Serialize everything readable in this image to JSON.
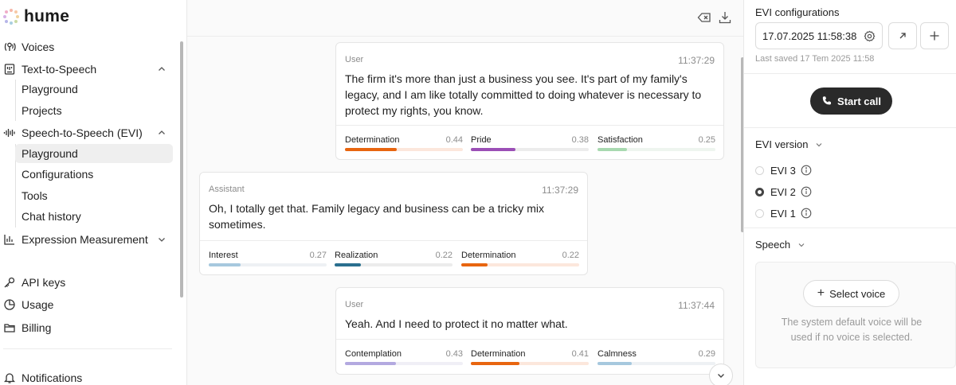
{
  "brand": {
    "name": "hume"
  },
  "sidebar": {
    "voices": "Voices",
    "tts": {
      "label": "Text-to-Speech",
      "items": [
        "Playground",
        "Projects"
      ]
    },
    "sts": {
      "label": "Speech-to-Speech (EVI)",
      "items": [
        "Playground",
        "Configurations",
        "Tools",
        "Chat history"
      ],
      "active": "Playground"
    },
    "expression": "Expression Measurement",
    "api_keys": "API keys",
    "usage": "Usage",
    "billing": "Billing",
    "notifications": "Notifications"
  },
  "chat": {
    "messages": [
      {
        "role": "User",
        "time": "11:37:29",
        "text": "The firm it's more than just a business you see. It's part of my family's legacy, and I am like totally committed to doing whatever is necessary to protect my rights, you know.",
        "emotions": [
          {
            "name": "Determination",
            "score": "0.44",
            "value": 0.44,
            "color": "#e8650f",
            "track": "#fce7dc"
          },
          {
            "name": "Pride",
            "score": "0.38",
            "value": 0.38,
            "color": "#9b4fb6",
            "track": "#ececec"
          },
          {
            "name": "Satisfaction",
            "score": "0.25",
            "value": 0.25,
            "color": "#a8d9b0",
            "track": "#eef5ef"
          }
        ]
      },
      {
        "role": "Assistant",
        "time": "11:37:29",
        "text": "Oh, I totally get that. Family legacy and business can be a tricky mix sometimes.",
        "emotions": [
          {
            "name": "Interest",
            "score": "0.27",
            "value": 0.27,
            "color": "#a6c8de",
            "track": "#eef1f4"
          },
          {
            "name": "Realization",
            "score": "0.22",
            "value": 0.22,
            "color": "#2a6f8f",
            "track": "#ececec"
          },
          {
            "name": "Determination",
            "score": "0.22",
            "value": 0.22,
            "color": "#e8650f",
            "track": "#fce7dc"
          }
        ]
      },
      {
        "role": "User",
        "time": "11:37:44",
        "text": "Yeah. And I need to protect it no matter what.",
        "emotions": [
          {
            "name": "Contemplation",
            "score": "0.43",
            "value": 0.43,
            "color": "#b3a9e0",
            "track": "#f0eff6"
          },
          {
            "name": "Determination",
            "score": "0.41",
            "value": 0.41,
            "color": "#e8650f",
            "track": "#fce7dc"
          },
          {
            "name": "Calmness",
            "score": "0.29",
            "value": 0.29,
            "color": "#a6c8de",
            "track": "#eef1f4"
          }
        ]
      }
    ]
  },
  "right": {
    "title": "EVI configurations",
    "config_value": "17.07.2025 11:58:38",
    "last_saved": "Last saved 17 Tem 2025 11:58",
    "start_call": "Start call",
    "evi_version": {
      "label": "EVI version",
      "options": [
        "EVI 3",
        "EVI 2",
        "EVI 1"
      ],
      "selected": "EVI 2"
    },
    "speech": {
      "label": "Speech",
      "select_voice": "Select voice",
      "hint": "The system default voice will be used if no voice is selected."
    }
  }
}
